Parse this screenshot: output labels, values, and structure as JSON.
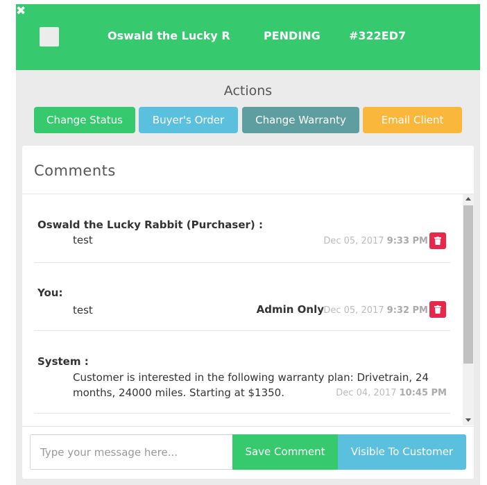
{
  "header": {
    "name": "Oswald the Lucky R",
    "status": "PENDING",
    "order_id": "#322ED7",
    "close_glyph": "✖",
    "bg_color": "#36c96e"
  },
  "actions": {
    "title": "Actions",
    "buttons": [
      {
        "label": "Change Status",
        "color": "#36c96e"
      },
      {
        "label": "Buyer's Order",
        "color": "#5bc0de"
      },
      {
        "label": "Change Warranty",
        "color": "#5f9ea0"
      },
      {
        "label": "Email Client",
        "color": "#f9b83b"
      }
    ]
  },
  "comments": {
    "title": "Comments",
    "items": [
      {
        "author": "Oswald the Lucky Rabbit (Purchaser) :",
        "message": "test",
        "date": "Dec 05, 2017",
        "time": "9:33 PM",
        "deletable": true
      },
      {
        "author": "You:",
        "message": "test",
        "visibility": "Admin Only",
        "date": "Dec 05, 2017",
        "time": "9:32 PM",
        "deletable": true
      },
      {
        "author": "System :",
        "message_line1": "Customer is interested in the following warranty plan: Drivetrain, 24",
        "message_line2": "months, 24000 miles. Starting at $1350.",
        "date": "Dec 04, 2017",
        "time": "10:45 PM",
        "deletable": false
      }
    ],
    "delete_icon": "trash-icon",
    "delete_color": "#e8284a"
  },
  "composer": {
    "placeholder": "Type your message here...",
    "value": "",
    "save_label": "Save Comment",
    "visible_label": "Visible To Customer"
  }
}
